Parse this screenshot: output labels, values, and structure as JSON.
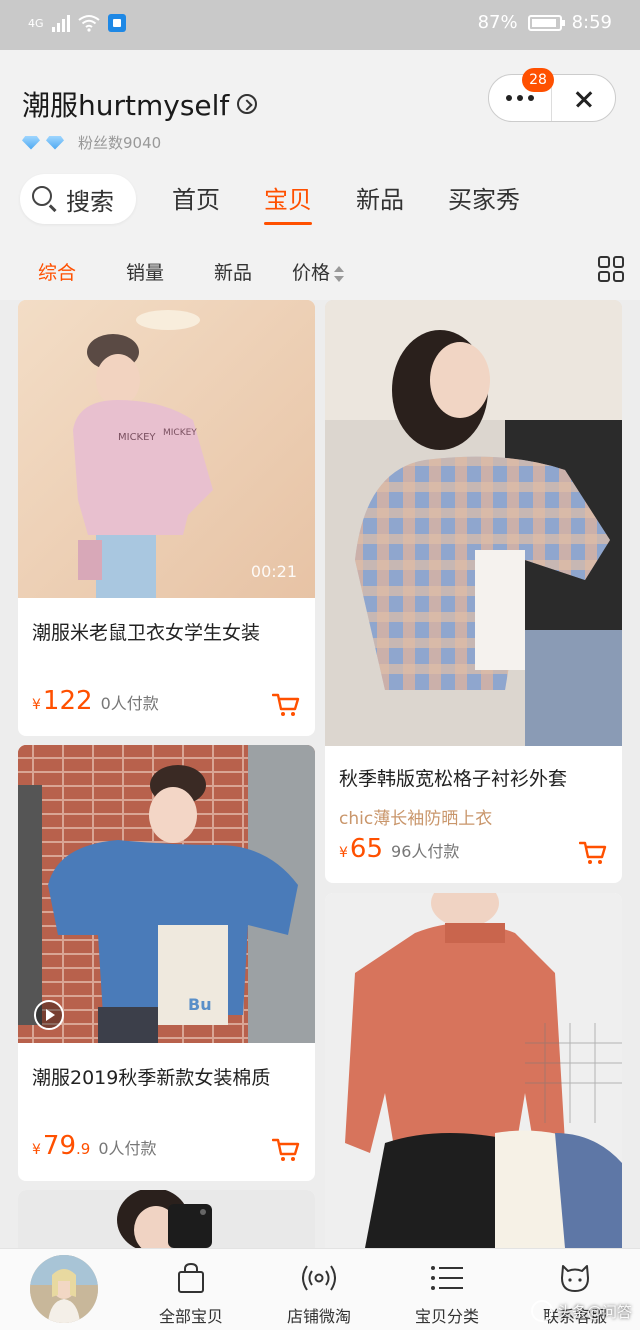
{
  "status_bar": {
    "network": "4G",
    "battery": "87%",
    "time": "8:59"
  },
  "shop": {
    "name": "潮服hurtmyself",
    "fans_label": "粉丝数9040",
    "notification_count": "28"
  },
  "nav": {
    "search_label": "搜索",
    "tabs": [
      {
        "label": "首页",
        "active": false
      },
      {
        "label": "宝贝",
        "active": true
      },
      {
        "label": "新品",
        "active": false
      },
      {
        "label": "买家秀",
        "active": false
      }
    ]
  },
  "sort": {
    "items": [
      {
        "label": "综合",
        "active": true
      },
      {
        "label": "销量",
        "active": false
      },
      {
        "label": "新品",
        "active": false
      },
      {
        "label": "价格",
        "active": false
      }
    ]
  },
  "products": [
    {
      "title": "潮服米老鼠卫衣女学生女装",
      "currency": "¥",
      "price_int": "122",
      "price_dec": "",
      "paid": "0人付款",
      "video_duration": "00:21"
    },
    {
      "title": "秋季韩版宽松格子衬衫外套",
      "subtitle": "chic薄长袖防晒上衣",
      "currency": "¥",
      "price_int": "65",
      "price_dec": "",
      "paid": "96人付款"
    },
    {
      "title": "潮服2019秋季新款女装棉质",
      "currency": "¥",
      "price_int": "79",
      "price_dec": ".9",
      "paid": "0人付款"
    },
    {
      "title": ""
    },
    {
      "title": ""
    }
  ],
  "bottom_bar": {
    "items": [
      {
        "label": "全部宝贝",
        "icon": "bag-icon"
      },
      {
        "label": "店铺微淘",
        "icon": "broadcast-icon"
      },
      {
        "label": "宝贝分类",
        "icon": "list-icon"
      },
      {
        "label": "联系客服",
        "icon": "chat-icon"
      }
    ]
  },
  "watermark": "头条@问答",
  "colors": {
    "accent": "#ff5000",
    "status_bar": "#c9c9c9",
    "background": "#ededed"
  }
}
